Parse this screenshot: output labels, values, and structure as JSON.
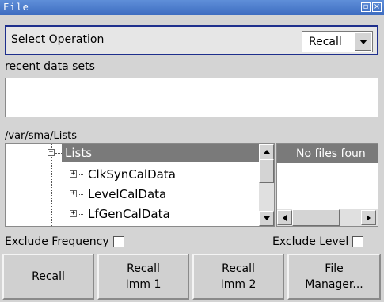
{
  "window": {
    "title": "File",
    "controls": [
      "maximize-icon",
      "close-icon"
    ]
  },
  "operation": {
    "label": "Select Operation",
    "selected": "Recall"
  },
  "recent": {
    "label": "recent data sets",
    "value": ""
  },
  "path": "/var/sma/Lists",
  "tree": {
    "root": "Lists",
    "items": [
      {
        "label": "ClkSynCalData",
        "expander": "+"
      },
      {
        "label": "LevelCalData",
        "expander": "+"
      },
      {
        "label": "LfGenCalData",
        "expander": "+"
      }
    ],
    "root_expander": "−"
  },
  "files": {
    "header": "No files foun"
  },
  "options": {
    "exclude_frequency": "Exclude Frequency",
    "exclude_level": "Exclude Level"
  },
  "buttons": {
    "recall": "Recall",
    "recall_imm1_line1": "Recall",
    "recall_imm1_line2": "Imm 1",
    "recall_imm2_line1": "Recall",
    "recall_imm2_line2": "Imm 2",
    "file_manager_line1": "File",
    "file_manager_line2": "Manager..."
  }
}
